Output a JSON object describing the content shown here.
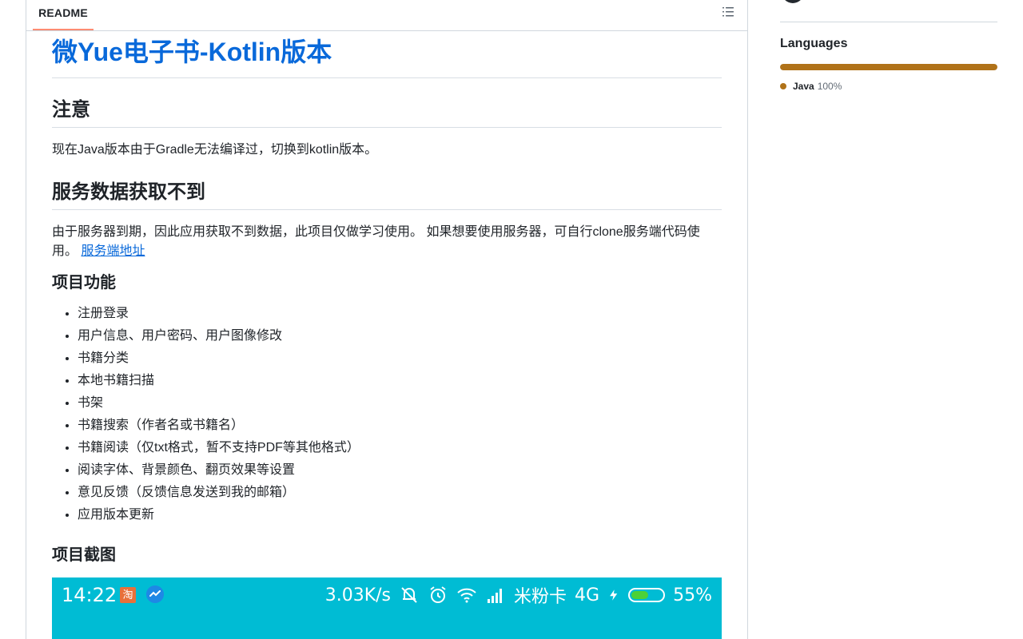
{
  "readme": {
    "tab_label": "README",
    "outline_icon": "list-unordered-icon",
    "title": "微Yue电子书-Kotlin版本",
    "section_notice": {
      "heading": "注意",
      "text": "现在Java版本由于Gradle无法编译过，切换到kotlin版本。"
    },
    "section_server": {
      "heading": "服务数据获取不到",
      "text": "由于服务器到期，因此应用获取不到数据，此项目仅做学习使用。 如果想要使用服务器，可自行clone服务端代码使用。 ",
      "link_text": "服务端地址"
    },
    "section_features": {
      "heading": "项目功能",
      "items": [
        "注册登录",
        "用户信息、用户密码、用户图像修改",
        "书籍分类",
        "本地书籍扫描",
        "书架",
        "书籍搜索（作者名或书籍名）",
        "书籍阅读（仅txt格式，暂不支持PDF等其他格式）",
        "阅读字体、背景颜色、翻页效果等设置",
        "意见反馈（反馈信息发送到我的邮箱）",
        "应用版本更新"
      ]
    },
    "section_screenshots": {
      "heading": "项目截图"
    },
    "screenshot_statusbar": {
      "time": "14:22",
      "taobao_icon": "淘",
      "speed": "3.03K/s",
      "carrier": "米粉卡",
      "network": "4G",
      "battery": "55%",
      "battery_level": 0.55,
      "background": "#00bcd4"
    }
  },
  "sidebar": {
    "languages_title": "Languages",
    "languages": [
      {
        "name": "Java",
        "percent": "100%",
        "color": "#b07219",
        "fraction": 1.0
      }
    ]
  },
  "colors": {
    "link": "#0969da",
    "tab_underline": "#fd8c73",
    "border": "#d0d7de"
  }
}
